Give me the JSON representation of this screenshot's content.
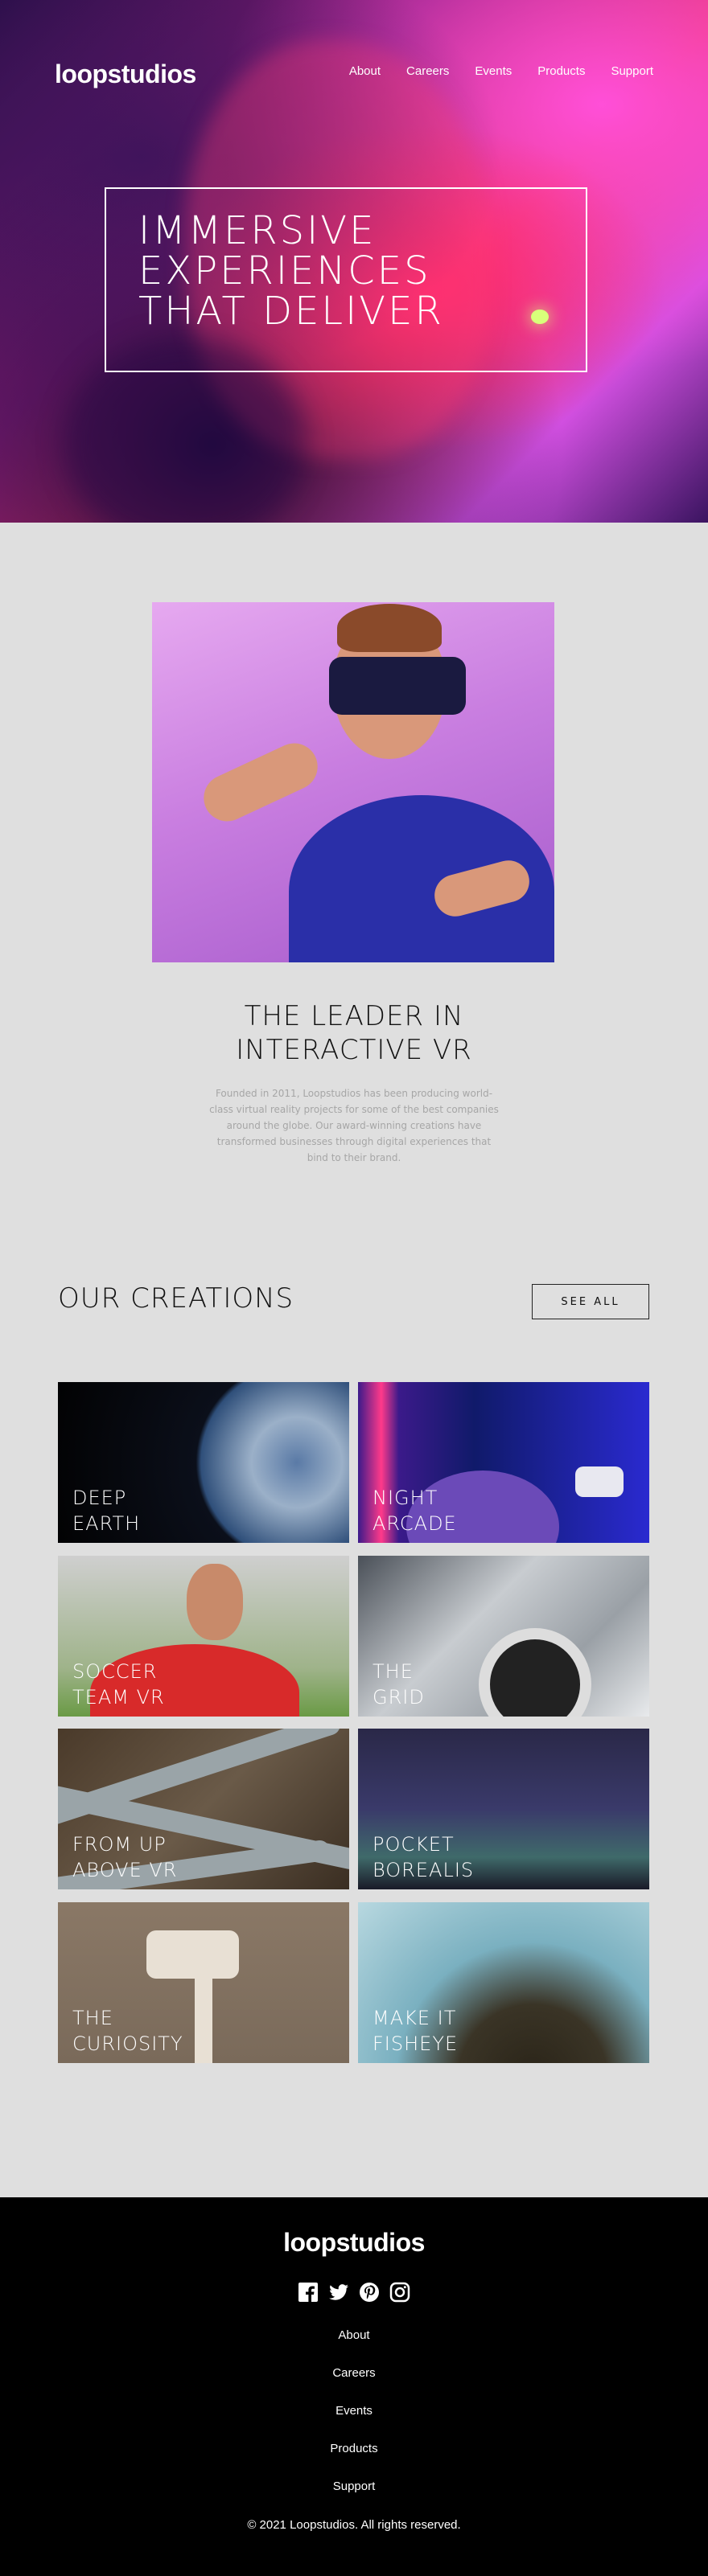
{
  "brand": {
    "logo": "loopstudios"
  },
  "nav": [
    "About",
    "Careers",
    "Events",
    "Products",
    "Support"
  ],
  "hero": {
    "title_lines": [
      "IMMERSIVE",
      "EXPERIENCES",
      "THAT DELIVER"
    ]
  },
  "intro": {
    "title_lines": [
      "THE LEADER IN",
      "INTERACTIVE VR"
    ],
    "text": "Founded in 2011, Loopstudios has been producing world-class virtual reality projects for some of the best companies around the globe. Our award-winning creations have transformed businesses through digital experiences that bind to their brand."
  },
  "creations": {
    "title": "OUR CREATIONS",
    "see_all": "SEE ALL",
    "items": [
      {
        "label": "DEEP\nEARTH"
      },
      {
        "label": "NIGHT\nARCADE"
      },
      {
        "label": "SOCCER\nTEAM VR"
      },
      {
        "label": "THE\nGRID"
      },
      {
        "label": "FROM UP\nABOVE VR"
      },
      {
        "label": "POCKET\nBOREALIS"
      },
      {
        "label": "THE\nCURIOSITY"
      },
      {
        "label": "MAKE IT\nFISHEYE"
      }
    ]
  },
  "footer": {
    "logo": "loopstudios",
    "social_icons": [
      "facebook-icon",
      "twitter-icon",
      "pinterest-icon",
      "instagram-icon"
    ],
    "nav": [
      "About",
      "Careers",
      "Events",
      "Products",
      "Support"
    ],
    "copyright": "© 2021 Loopstudios. All rights reserved."
  }
}
